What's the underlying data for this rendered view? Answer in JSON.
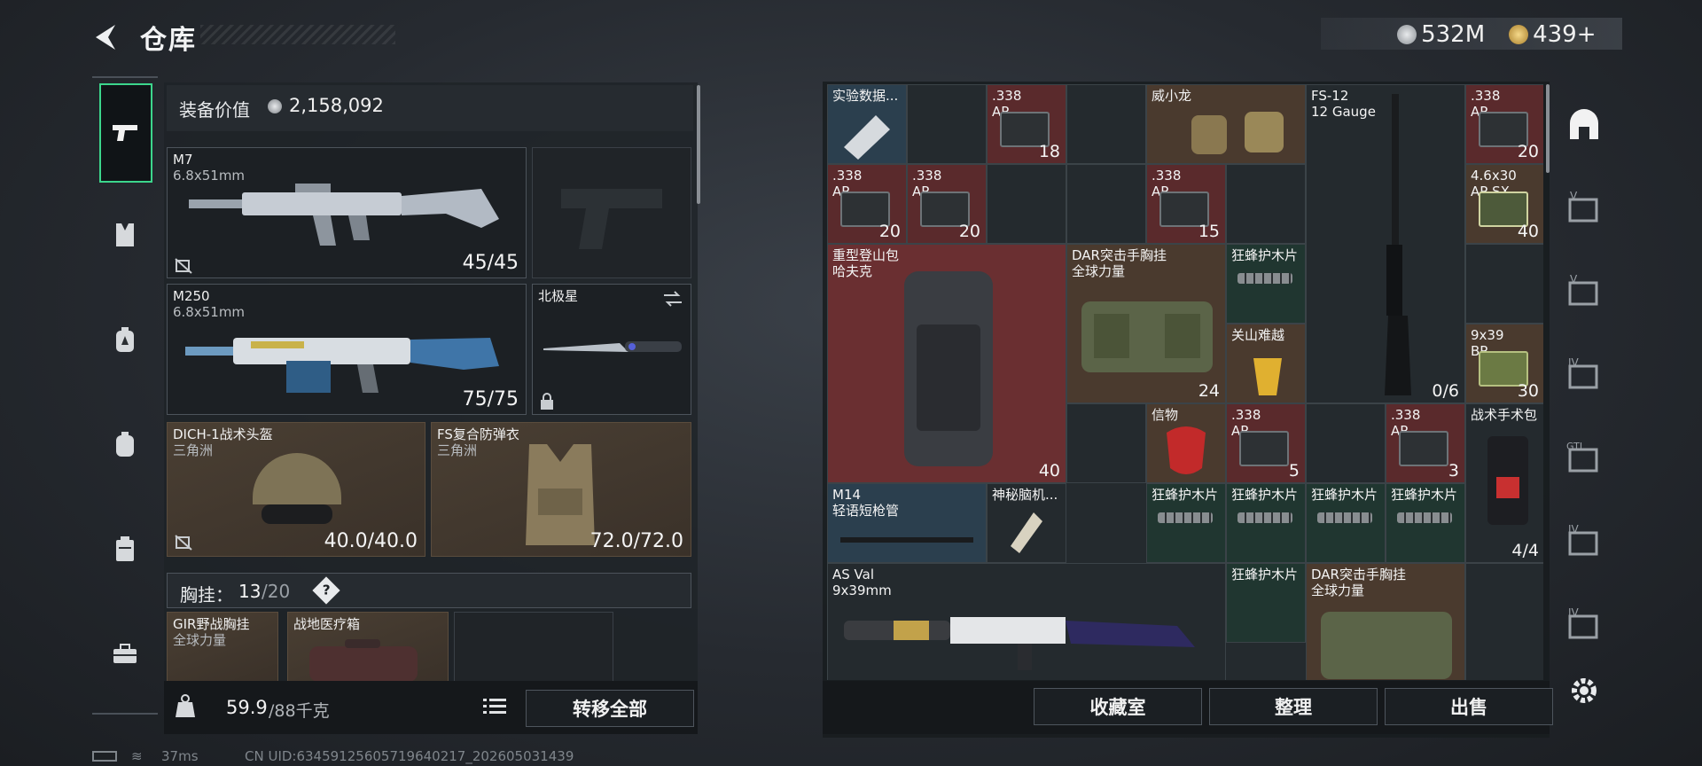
{
  "header": {
    "title": "仓库",
    "currency": [
      {
        "icon": "silver-coin-icon",
        "value": "532M",
        "color": "#c8ccd0"
      },
      {
        "icon": "gold-coin-icon",
        "value": "439+",
        "color": "#d9b25a"
      }
    ]
  },
  "left_nav": [
    {
      "icon": "pistol-icon",
      "active": true
    },
    {
      "icon": "vest-icon"
    },
    {
      "icon": "backpack-badge-icon"
    },
    {
      "icon": "backpack-icon"
    },
    {
      "icon": "case-icon"
    },
    {
      "icon": "toolbox-icon"
    }
  ],
  "equipment": {
    "value_label": "装备价值",
    "value": "2,158,092",
    "weapons": [
      {
        "name": "M7",
        "caliber": "6.8x51mm",
        "ammo": "45/45"
      },
      {
        "name": "M250",
        "caliber": "6.8x51mm",
        "ammo": "75/75"
      }
    ],
    "knife": {
      "name": "北极星"
    },
    "helmet": {
      "name": "DICH-1战术头盔",
      "brand": "三角洲",
      "durability": "40.0/40.0"
    },
    "armor": {
      "name": "FS复合防弹衣",
      "brand": "三角洲",
      "durability": "72.0/72.0"
    },
    "chest_label": "胸挂：",
    "chest_used": "13",
    "chest_total": "/20",
    "chest_help": "?",
    "chest_items": [
      {
        "name": "GIR野战胸挂",
        "sub": "全球力量"
      },
      {
        "name": "战地医疗箱",
        "sub": ""
      }
    ],
    "weight_current": "59.9",
    "weight_max": "/88千克",
    "transfer_all": "转移全部"
  },
  "grid": {
    "items": [
      {
        "name": "实验数据...",
        "sub": ""
      },
      {
        "name": ".338",
        "sub": "AP",
        "count": "18"
      },
      {
        "name": "威小龙",
        "sub": ""
      },
      {
        "name": "FS-12",
        "sub": "12 Gauge",
        "count": "0/6"
      },
      {
        "name": ".338",
        "sub": "AP",
        "count": "20"
      },
      {
        "name": ".338",
        "sub": "AP",
        "count": "20"
      },
      {
        "name": ".338",
        "sub": "AP",
        "count": "20"
      },
      {
        "name": ".338",
        "sub": "AP",
        "count": "15"
      },
      {
        "name": "4.6x30",
        "sub": "AP SX",
        "count": "40"
      },
      {
        "name": "重型登山包",
        "sub": "哈夫克",
        "count": "40"
      },
      {
        "name": "DAR突击手胸挂",
        "sub": "全球力量",
        "count": "24"
      },
      {
        "name": "狂蜂护木片",
        "sub": ""
      },
      {
        "name": "关山难越",
        "sub": ""
      },
      {
        "name": "9x39",
        "sub": "BP",
        "count": "30"
      },
      {
        "name": "信物",
        "sub": ""
      },
      {
        "name": ".338",
        "sub": "AP",
        "count": "5"
      },
      {
        "name": ".338",
        "sub": "AP",
        "count": "3"
      },
      {
        "name": "战术手术包",
        "sub": "",
        "count": "4/4"
      },
      {
        "name": "M14",
        "sub": "轻语短枪管"
      },
      {
        "name": "神秘脑机...",
        "sub": ""
      },
      {
        "name": "狂蜂护木片",
        "sub": ""
      },
      {
        "name": "狂蜂护木片",
        "sub": ""
      },
      {
        "name": "狂蜂护木片",
        "sub": ""
      },
      {
        "name": "狂蜂护木片",
        "sub": ""
      },
      {
        "name": "AS Val",
        "sub": "9x39mm"
      },
      {
        "name": "狂蜂护木片",
        "sub": ""
      },
      {
        "name": "DAR突击手胸挂",
        "sub": "全球力量"
      }
    ],
    "buttons": {
      "collection": "收藏室",
      "organize": "整理",
      "sell": "出售"
    }
  },
  "right_nav": [
    {
      "icon": "vault-icon"
    },
    {
      "icon": "case-v-icon"
    },
    {
      "icon": "case-v2-icon"
    },
    {
      "icon": "case-iv-icon"
    },
    {
      "icon": "case-gti-icon"
    },
    {
      "icon": "case-iv2-icon"
    },
    {
      "icon": "case-iv3-icon"
    },
    {
      "icon": "settings-icon"
    }
  ],
  "status": {
    "ping": "37ms",
    "uid": "CN UID:634591256057196402​17_202605031439"
  }
}
